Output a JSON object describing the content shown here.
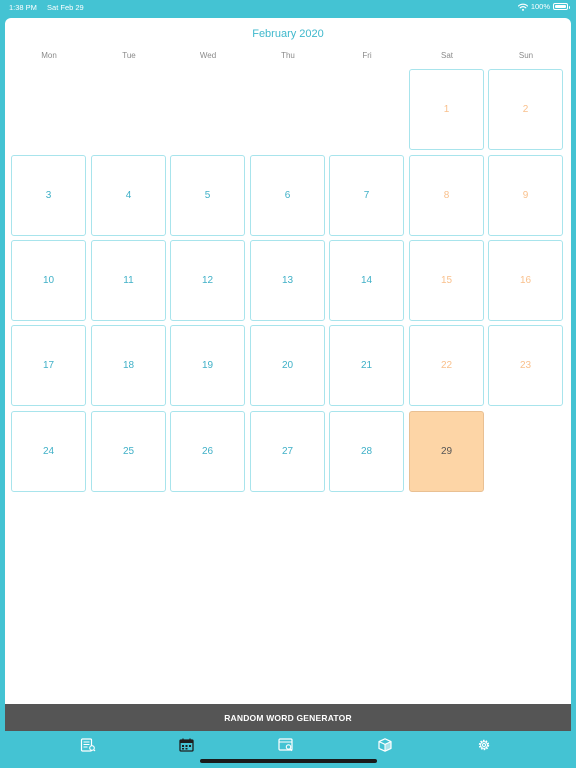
{
  "status": {
    "time": "1:38 PM",
    "date": "Sat Feb 29",
    "battery": "100%"
  },
  "calendar": {
    "title": "February 2020",
    "weekdays": [
      "Mon",
      "Tue",
      "Wed",
      "Thu",
      "Fri",
      "Sat",
      "Sun"
    ],
    "days": [
      "1",
      "2",
      "3",
      "4",
      "5",
      "6",
      "7",
      "8",
      "9",
      "10",
      "11",
      "12",
      "13",
      "14",
      "15",
      "16",
      "17",
      "18",
      "19",
      "20",
      "21",
      "22",
      "23",
      "24",
      "25",
      "26",
      "27",
      "28",
      "29"
    ],
    "today": "29"
  },
  "footer": {
    "generator_label": "RANDOM WORD GENERATOR"
  },
  "tabs": [
    {
      "icon": "dictionary-icon"
    },
    {
      "icon": "calendar-icon"
    },
    {
      "icon": "browser-search-icon"
    },
    {
      "icon": "cube-icon"
    },
    {
      "icon": "gear-icon"
    }
  ],
  "colors": {
    "accent": "#44c3d3",
    "weekday_text": "#3fb0c7",
    "weekend_text": "#f9c08c",
    "today_bg": "#fdd5a6",
    "generator_bar": "#555555"
  }
}
